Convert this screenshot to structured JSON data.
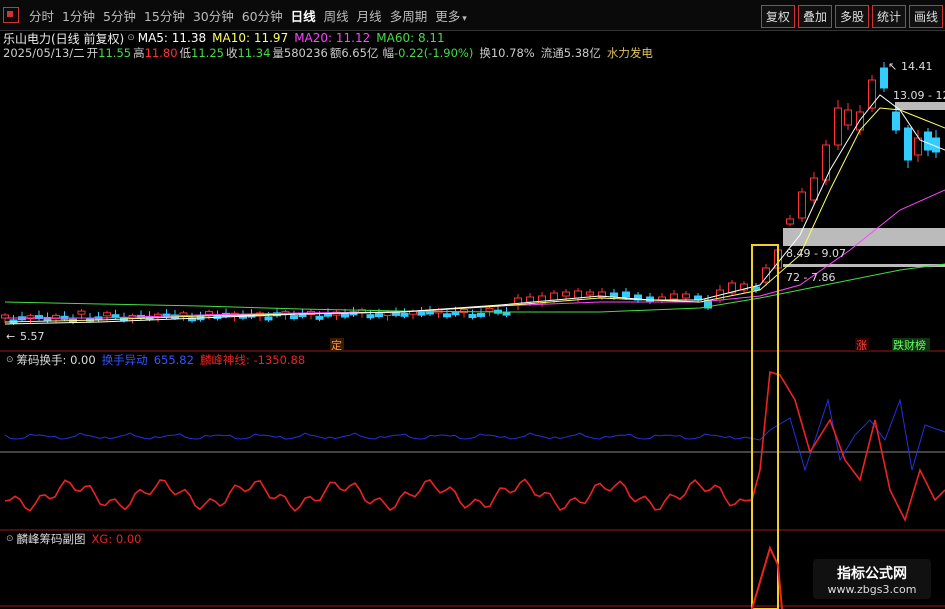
{
  "toolbar": {
    "periods": [
      "分时",
      "1分钟",
      "5分钟",
      "15分钟",
      "30分钟",
      "60分钟",
      "日线",
      "周线",
      "月线",
      "多周期",
      "更多"
    ],
    "right_buttons": [
      "复权",
      "叠加",
      "多股",
      "统计",
      "画线"
    ],
    "more_icon": "chevron-down-icon"
  },
  "header": {
    "stock_name": "乐山电力(日线 前复权)",
    "ma5": "MA5: 11.38",
    "ma10": "MA10: 11.97",
    "ma20": "MA20: 11.12",
    "ma60": "MA60: 8.11",
    "date": "2025/05/13/二",
    "open_label": "开",
    "open": "11.55",
    "high_label": "高",
    "high": "11.80",
    "low_label": "低",
    "low": "11.25",
    "close_label": "收",
    "close": "11.34",
    "vol_label": "量",
    "vol": "580236",
    "amount_label": "额",
    "amount": "6.65亿",
    "change_label": "幅",
    "change": "-0.22(-1.90%)",
    "turnover": "换10.78%",
    "float": "流通5.38亿",
    "industry": "水力发电"
  },
  "chart_labels": {
    "high_mark": "14.41",
    "low_mark": "5.57",
    "zone1": "13.09 - 12",
    "zone2": "8.49 - 9.07",
    "zone3": "72 - 7.86",
    "tag_ding": "定",
    "tag_zhang": "涨",
    "tag_diecai": "跌财榜"
  },
  "sub1": {
    "name": "筹码换手",
    "value": ": 0.00",
    "s1_name": "换手异动",
    "s1_value": "655.82",
    "s2_name": "麟峰神线",
    "s2_value": ": -1350.88"
  },
  "sub2": {
    "name": "麟峰筹码副图",
    "xg": "XG: 0.00"
  },
  "watermark": {
    "line1": "指标公式网",
    "line2": "www.zbgs3.com"
  },
  "colors": {
    "up": "#ff3333",
    "down": "#33ccff",
    "ma5": "#ffffff",
    "ma10": "#ffff66",
    "ma20": "#ff44ff",
    "ma60": "#44dd44",
    "highlight": "#f0d020"
  }
}
